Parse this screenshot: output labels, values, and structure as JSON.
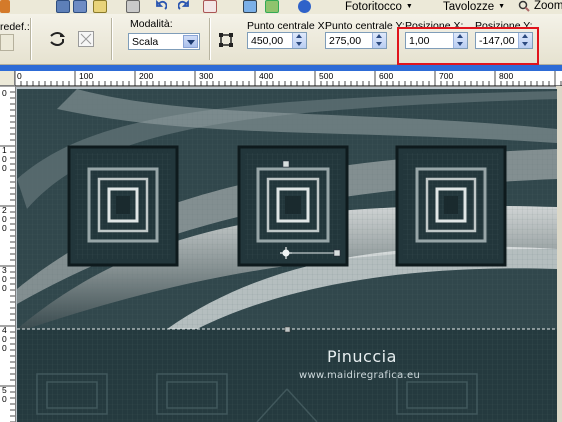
{
  "toolbar": {
    "menus": [
      {
        "label": "Fotoritocco",
        "has_dropdown": true
      },
      {
        "label": "Tavolozze",
        "has_dropdown": true
      },
      {
        "label": "Zoom",
        "has_dropdown": false
      }
    ],
    "icons": [
      "app-icon",
      "save-icon",
      "disk-icon",
      "folder-icon",
      "printer-icon",
      "undo-icon",
      "redo-icon",
      "copy-icon",
      "paste-icon",
      "help-icon",
      "magnifier-icon"
    ]
  },
  "options": {
    "preset_label": "redef.:",
    "mode_label": "Modalità:",
    "mode_value": "Scala",
    "center_x_label": "Punto centrale X:",
    "center_x_value": "450,00",
    "center_y_label": "Punto centrale Y:",
    "center_y_value": "275,00",
    "pos_x_label": "Posizione X:",
    "pos_x_value": "1,00",
    "pos_y_label": "Posizione Y:",
    "pos_y_value": "-147,00"
  },
  "rulers": {
    "top": [
      "0",
      "100",
      "200",
      "300",
      "400",
      "500",
      "600",
      "700",
      "800"
    ],
    "left": [
      "0",
      "1 0 0",
      "2 0 0",
      "3 0 0",
      "4 0 0",
      "5 0"
    ]
  },
  "canvas": {
    "watermark_name": "Pinuccia",
    "watermark_url": "www.maidiregrafica.eu"
  },
  "colors": {
    "highlight": "#e0141c",
    "canvas_bg": "#23363b"
  }
}
